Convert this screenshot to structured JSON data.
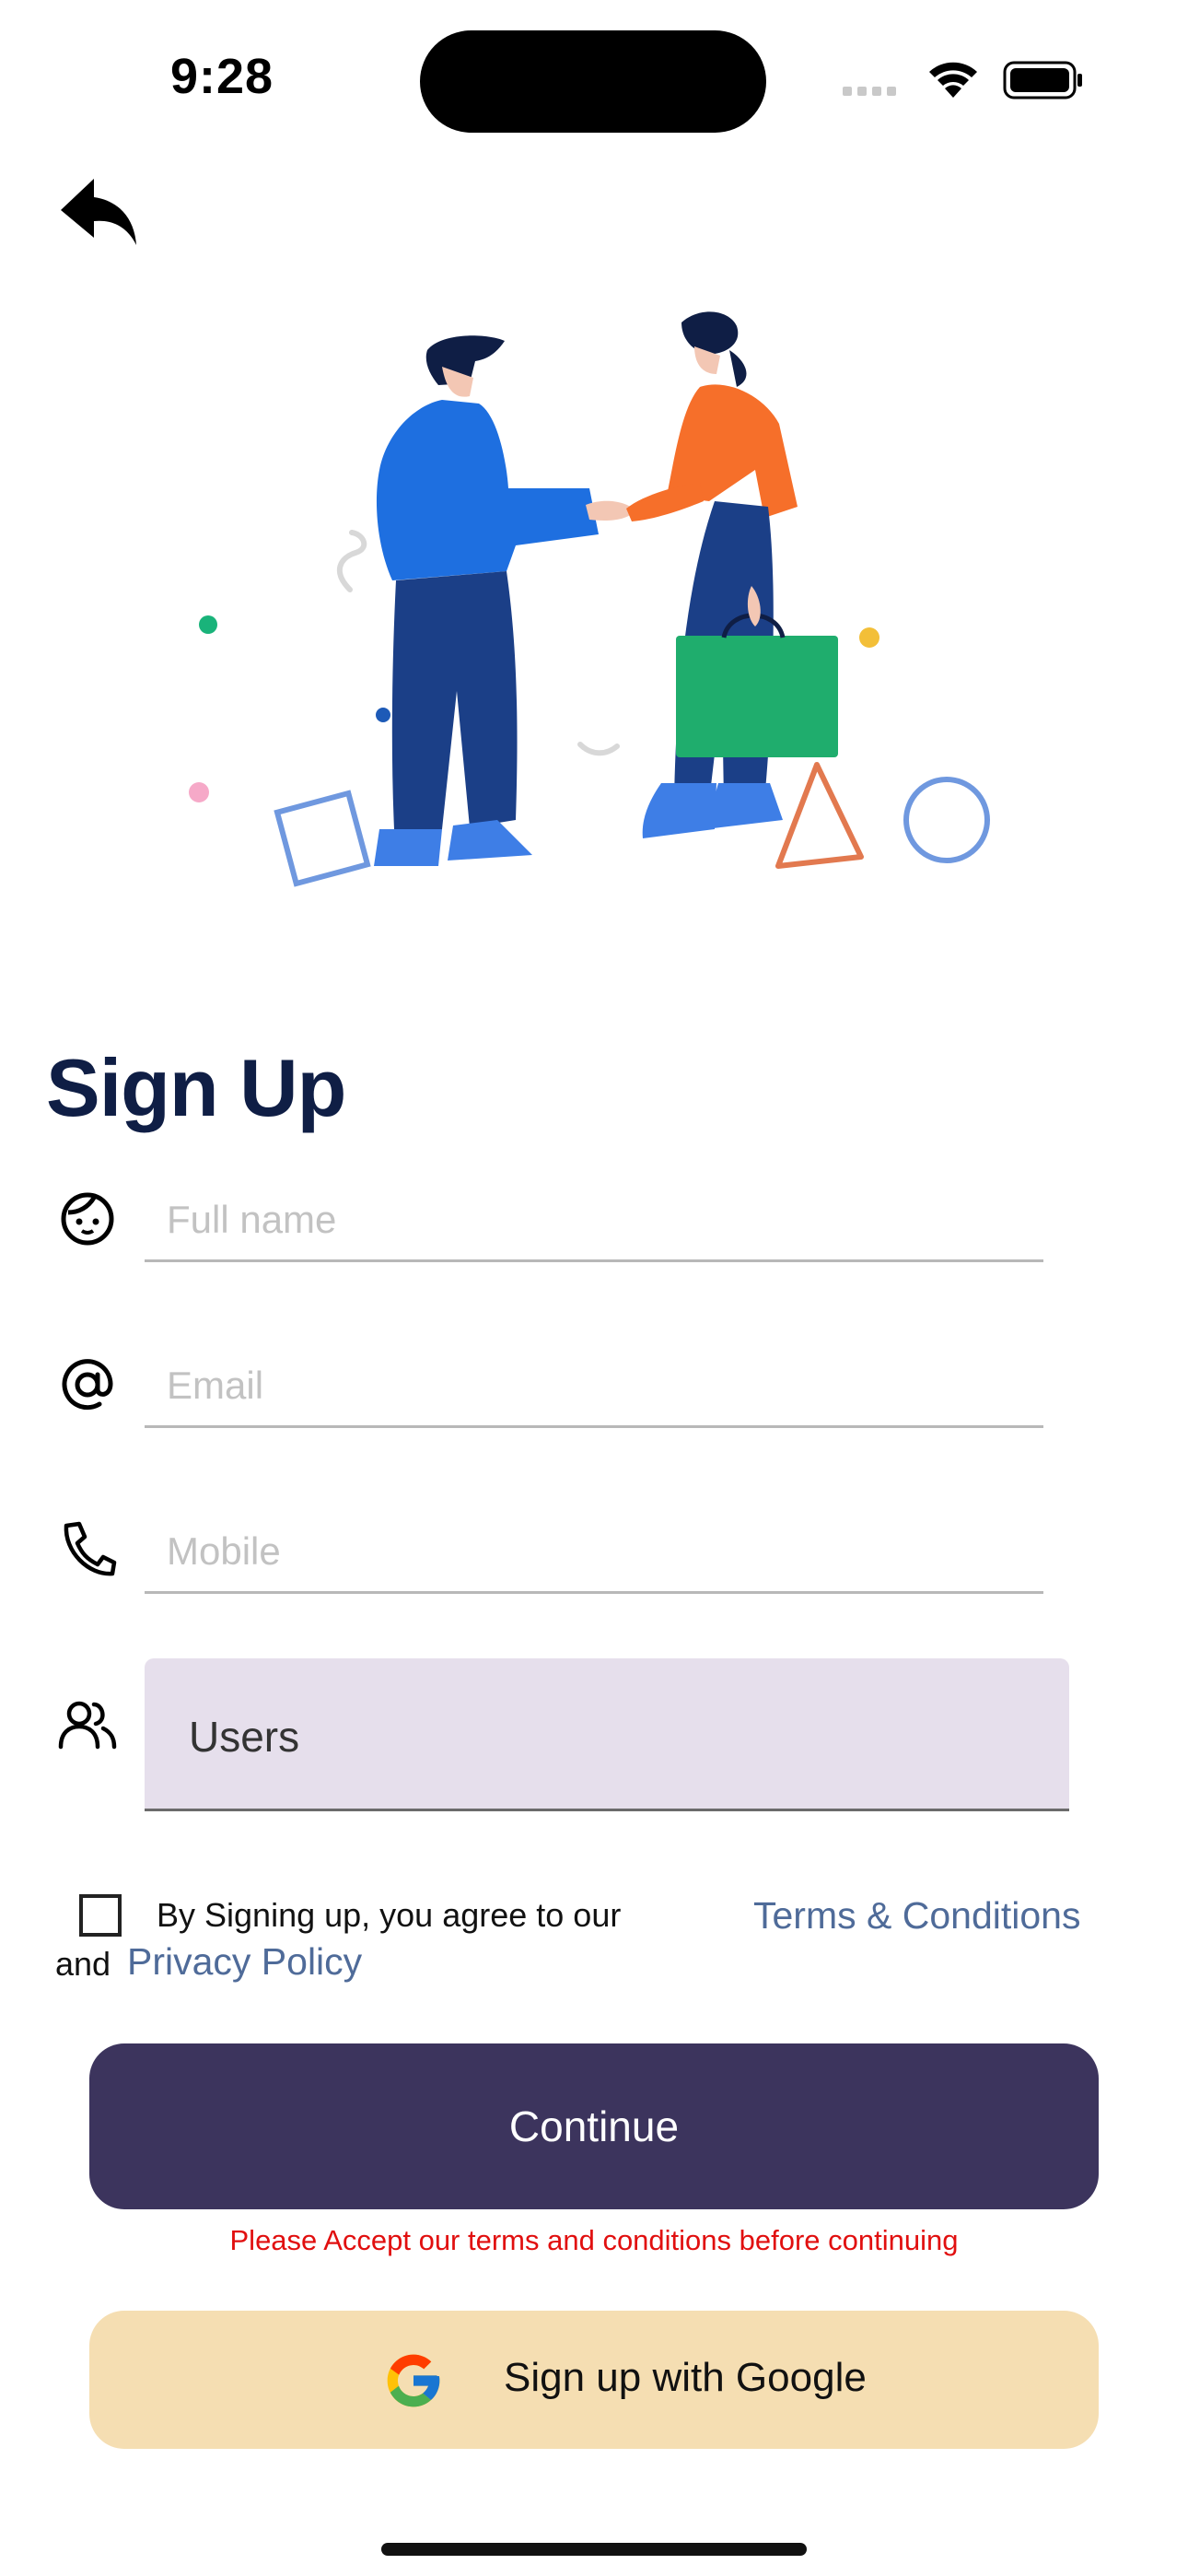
{
  "status_bar": {
    "time": "9:28"
  },
  "illustration": {
    "name": "handshake-illustration"
  },
  "title": "Sign Up",
  "fields": {
    "full_name": {
      "placeholder": "Full name",
      "value": ""
    },
    "email": {
      "placeholder": "Email",
      "value": ""
    },
    "mobile": {
      "placeholder": "Mobile",
      "value": ""
    }
  },
  "role_select": {
    "value": "Users"
  },
  "agreement": {
    "checked": false,
    "text": "By Signing up, you agree to our",
    "terms_link": "Terms & Conditions",
    "and": "and",
    "privacy_link": "Privacy Policy"
  },
  "continue_button": "Continue",
  "error_message": "Please Accept our terms and conditions before continuing",
  "google_button": "Sign up with Google",
  "colors": {
    "title": "#0f1e45",
    "continue_bg": "#3c345d",
    "google_bg": "#f5deb2",
    "select_bg": "#e6dfec",
    "link": "#4f6b99",
    "error": "#e10f0f"
  }
}
